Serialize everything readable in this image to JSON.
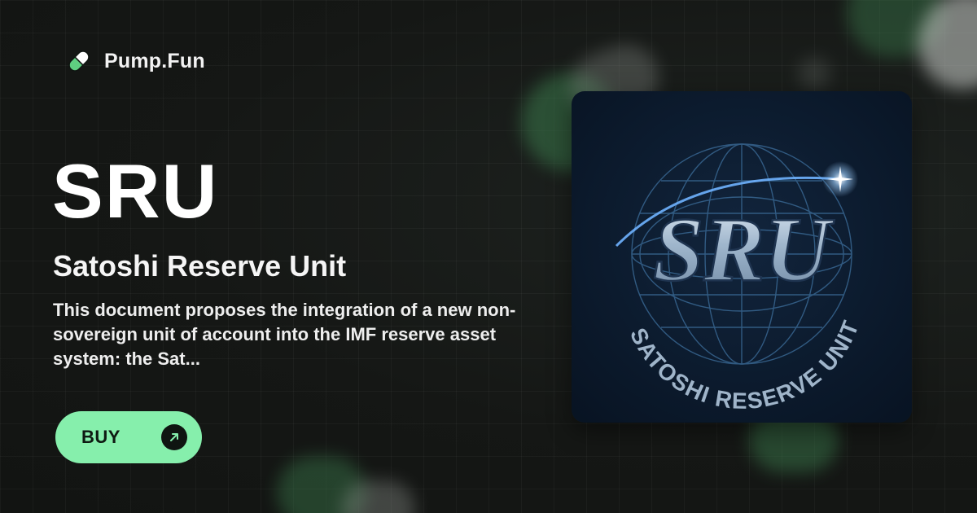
{
  "brand": {
    "name": "Pump.Fun",
    "icon": "pill-icon"
  },
  "token": {
    "ticker": "SRU",
    "name": "Satoshi Reserve Unit",
    "description": "This document proposes the integration of a new non-sovereign unit of account into the IMF reserve asset system: the Sat...",
    "logo": {
      "main_text": "SRU",
      "arc_text": "SATOSHI RESERVE UNIT"
    }
  },
  "cta": {
    "label": "BUY",
    "icon": "arrow-up-right-icon"
  },
  "colors": {
    "accent": "#86efac",
    "background": "#151715"
  }
}
